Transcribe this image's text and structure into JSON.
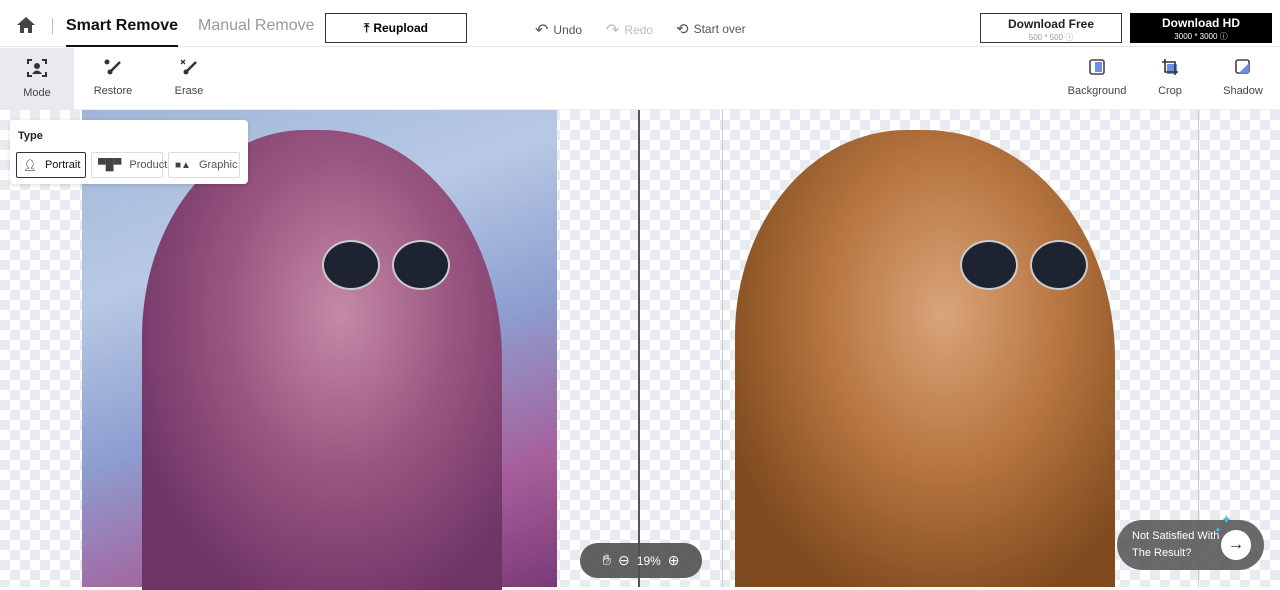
{
  "header": {
    "tabs": [
      {
        "label": "Smart Remove",
        "active": true
      },
      {
        "label": "Manual Remove",
        "active": false
      }
    ],
    "reupload_label": "Reupload",
    "undo_label": "Undo",
    "redo_label": "Redo",
    "start_over_label": "Start over",
    "download_free": {
      "label": "Download Free",
      "size": "500 * 500"
    },
    "download_hd": {
      "label": "Download HD",
      "size": "3000 * 3000"
    }
  },
  "toolbar": {
    "left": [
      {
        "label": "Mode"
      },
      {
        "label": "Restore"
      },
      {
        "label": "Erase"
      }
    ],
    "right": [
      {
        "label": "Background"
      },
      {
        "label": "Crop"
      },
      {
        "label": "Shadow"
      }
    ]
  },
  "type_panel": {
    "title": "Type",
    "options": [
      {
        "label": "Portrait",
        "selected": true
      },
      {
        "label": "Product"
      },
      {
        "label": "Graphic"
      }
    ]
  },
  "zoom": {
    "level": "19%"
  },
  "feedback": {
    "line1": "Not Satisfied With",
    "line2": "The Result?"
  },
  "colors": {
    "accent": "#000000",
    "sparkle": "#34c6d6"
  }
}
